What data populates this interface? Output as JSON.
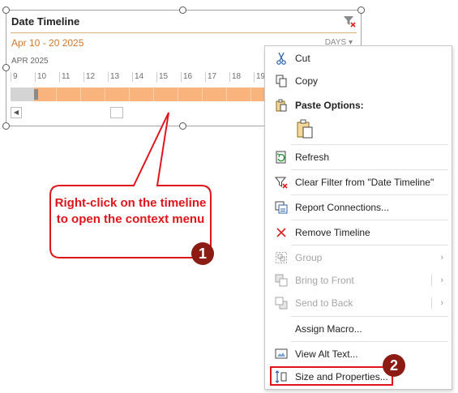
{
  "timeline": {
    "title": "Date Timeline",
    "range": "Apr 10 - 20 2025",
    "level": "DAYS ▾",
    "year": "APR 2025",
    "days": [
      "9",
      "10",
      "11",
      "12",
      "13",
      "14",
      "15",
      "16",
      "17",
      "18",
      "19"
    ],
    "selection_color": "#f8b47c",
    "range_color": "#d0772d"
  },
  "callout": {
    "text": "Right-click on the timeline to open the context menu",
    "badge": "1",
    "color": "#e0141b"
  },
  "badge2": "2",
  "menu": {
    "cut": "Cut",
    "copy": "Copy",
    "paste_options": "Paste Options:",
    "refresh": "Refresh",
    "clear_filter": "Clear Filter from \"Date Timeline\"",
    "report_connections": "Report Connections...",
    "remove_timeline": "Remove Timeline",
    "group": "Group",
    "bring_to_front": "Bring to Front",
    "send_to_back": "Send to Back",
    "assign_macro": "Assign Macro...",
    "view_alt_text": "View Alt Text...",
    "size_and_properties": "Size and Properties...",
    "submenu_arrow": "›"
  },
  "icons": {
    "cut": "scissors-icon",
    "copy": "copy-icon",
    "paste": "clipboard-icon",
    "refresh": "refresh-icon",
    "clear_filter": "clear-filter-icon",
    "report_connections": "report-connections-icon",
    "remove": "x-icon",
    "group": "group-icon",
    "bring_to_front": "bring-to-front-icon",
    "send_to_back": "send-to-back-icon",
    "alt_text": "alt-text-icon",
    "size": "size-properties-icon"
  },
  "colors": {
    "accent": "#e0141b",
    "badge": "#8b1b13"
  }
}
